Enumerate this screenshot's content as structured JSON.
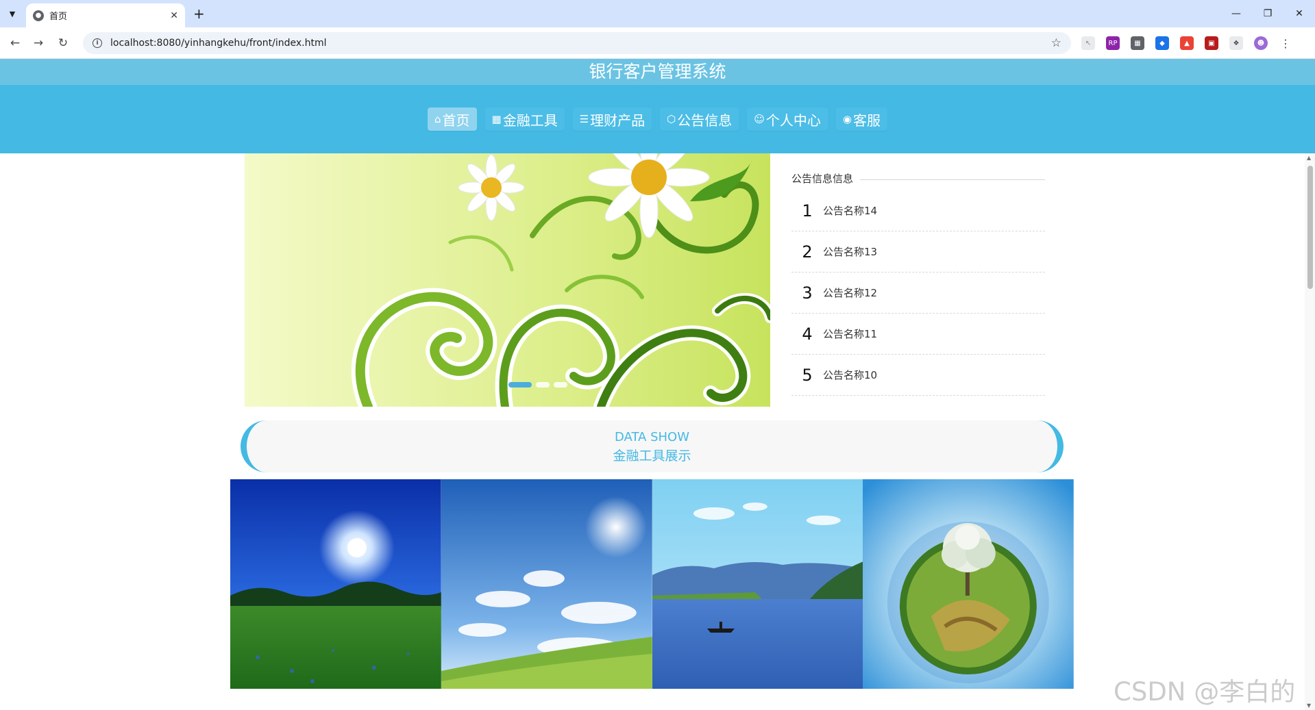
{
  "browser": {
    "tab_title": "首页",
    "url": "localhost:8080/yinhangkehu/front/index.html"
  },
  "site": {
    "title": "银行客户管理系统"
  },
  "nav": [
    {
      "label": "首页",
      "icon": "home-icon"
    },
    {
      "label": "金融工具",
      "icon": "grid-icon"
    },
    {
      "label": "理财产品",
      "icon": "layers-icon"
    },
    {
      "label": "公告信息",
      "icon": "cube-icon"
    },
    {
      "label": "个人中心",
      "icon": "user-icon"
    },
    {
      "label": "客服",
      "icon": "chat-icon"
    }
  ],
  "notice": {
    "heading": "公告信息信息",
    "items": [
      {
        "num": "1",
        "title": "公告名称14"
      },
      {
        "num": "2",
        "title": "公告名称13"
      },
      {
        "num": "3",
        "title": "公告名称12"
      },
      {
        "num": "4",
        "title": "公告名称11"
      },
      {
        "num": "5",
        "title": "公告名称10"
      }
    ]
  },
  "banner": {
    "slide_count": 3,
    "active_slide": 1
  },
  "data_show": {
    "en_title": "DATA SHOW",
    "cn_title": "金融工具展示"
  },
  "watermark": "CSDN @李白的粉",
  "colors": {
    "accent": "#44b9e4",
    "title_bar": "#6bc3e3"
  }
}
